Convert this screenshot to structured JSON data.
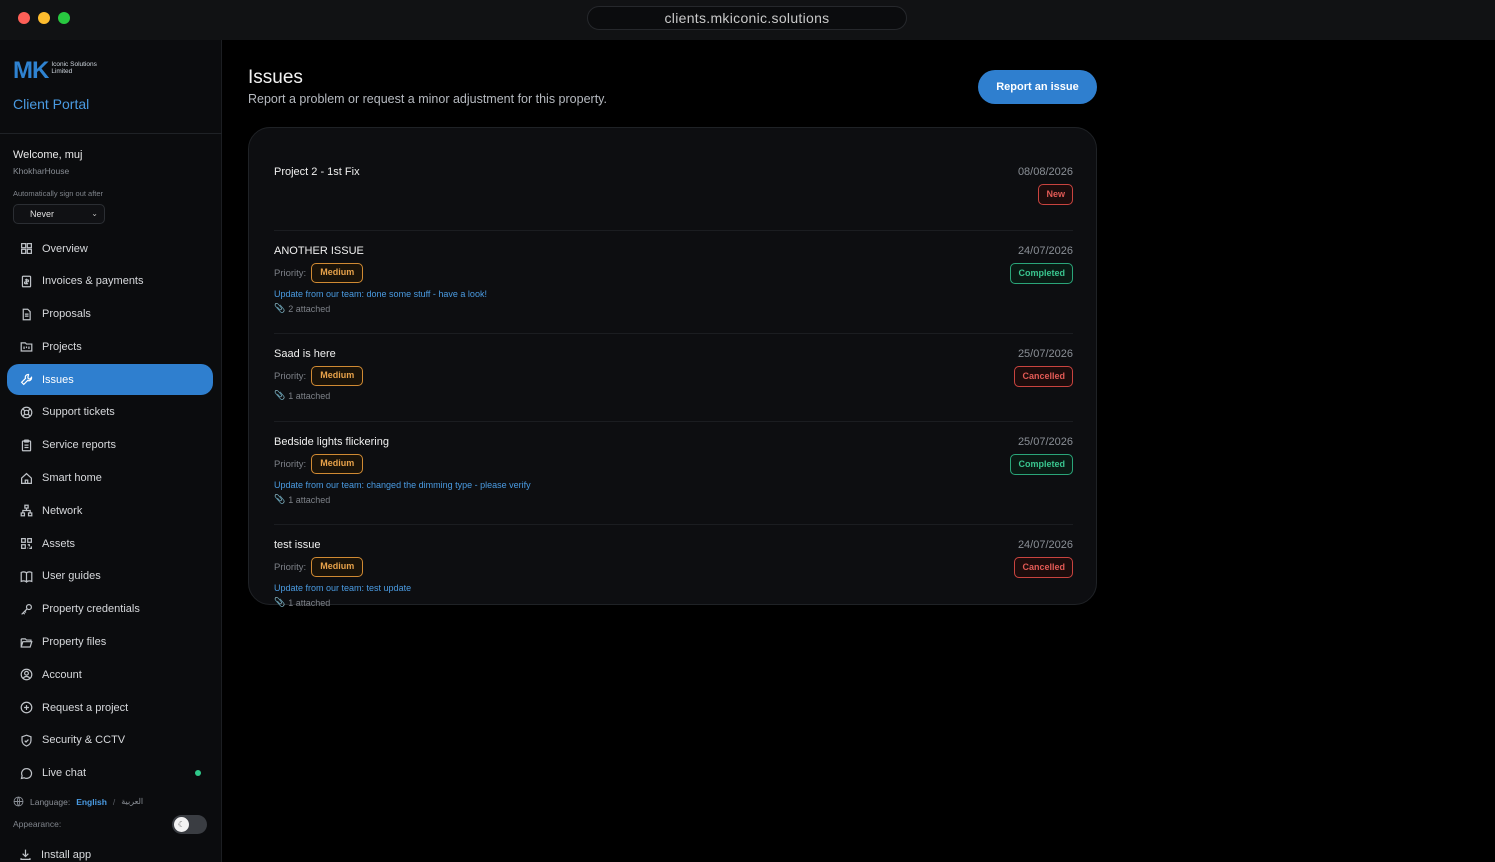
{
  "browser": {
    "url": "clients.mkiconic.solutions"
  },
  "brand": {
    "logo_mark": "MK",
    "logo_line1": "Iconic Solutions",
    "logo_line2": "Limited",
    "portal_label": "Client Portal",
    "accent_color": "#2f7fcf"
  },
  "user": {
    "welcome": "Welcome, muj",
    "property": "KhokharHouse",
    "auto_signout_label": "Automatically sign out after",
    "auto_signout_value": "Never"
  },
  "nav": {
    "items": [
      {
        "label": "Overview",
        "icon": "grid-icon"
      },
      {
        "label": "Invoices & payments",
        "icon": "invoice-icon"
      },
      {
        "label": "Proposals",
        "icon": "document-icon"
      },
      {
        "label": "Projects",
        "icon": "folder-kanban-icon"
      },
      {
        "label": "Issues",
        "icon": "wrench-icon",
        "active": true
      },
      {
        "label": "Support tickets",
        "icon": "lifebuoy-icon"
      },
      {
        "label": "Service reports",
        "icon": "clipboard-icon"
      },
      {
        "label": "Smart home",
        "icon": "home-icon"
      },
      {
        "label": "Network",
        "icon": "network-icon"
      },
      {
        "label": "Assets",
        "icon": "qr-icon"
      },
      {
        "label": "User guides",
        "icon": "book-icon"
      },
      {
        "label": "Property credentials",
        "icon": "key-icon"
      },
      {
        "label": "Property files",
        "icon": "folder-open-icon"
      },
      {
        "label": "Account",
        "icon": "user-circle-icon"
      },
      {
        "label": "Request a project",
        "icon": "plus-circle-icon"
      },
      {
        "label": "Security & CCTV",
        "icon": "shield-icon"
      },
      {
        "label": "Live chat",
        "icon": "chat-icon",
        "online": true
      }
    ],
    "language_label": "Language:",
    "language_english": "English",
    "language_separator": "/",
    "language_arabic": "العربية",
    "appearance_label": "Appearance:",
    "install_label": "Install app"
  },
  "page": {
    "title": "Issues",
    "subtitle": "Report a problem or request a minor adjustment for this property.",
    "report_button": "Report an issue"
  },
  "issues": [
    {
      "title": "Project 2 - 1st Fix",
      "date": "08/08/2026",
      "status": "New",
      "status_kind": "new"
    },
    {
      "title": "ANOTHER ISSUE",
      "date": "24/07/2026",
      "status": "Completed",
      "status_kind": "completed",
      "priority_label": "Priority:",
      "priority": "Medium",
      "update": "Update from our team: done some stuff - have a look!",
      "attachments": "2 attached"
    },
    {
      "title": "Saad is here",
      "date": "25/07/2026",
      "status": "Cancelled",
      "status_kind": "cancelled",
      "priority_label": "Priority:",
      "priority": "Medium",
      "attachments": "1 attached"
    },
    {
      "title": "Bedside lights flickering",
      "date": "25/07/2026",
      "status": "Completed",
      "status_kind": "completed",
      "priority_label": "Priority:",
      "priority": "Medium",
      "update": "Update from our team: changed the dimming type - please verify",
      "attachments": "1 attached"
    },
    {
      "title": "test issue",
      "date": "24/07/2026",
      "status": "Cancelled",
      "status_kind": "cancelled",
      "priority_label": "Priority:",
      "priority": "Medium",
      "update": "Update from our team: test update",
      "attachments": "1 attached"
    }
  ]
}
